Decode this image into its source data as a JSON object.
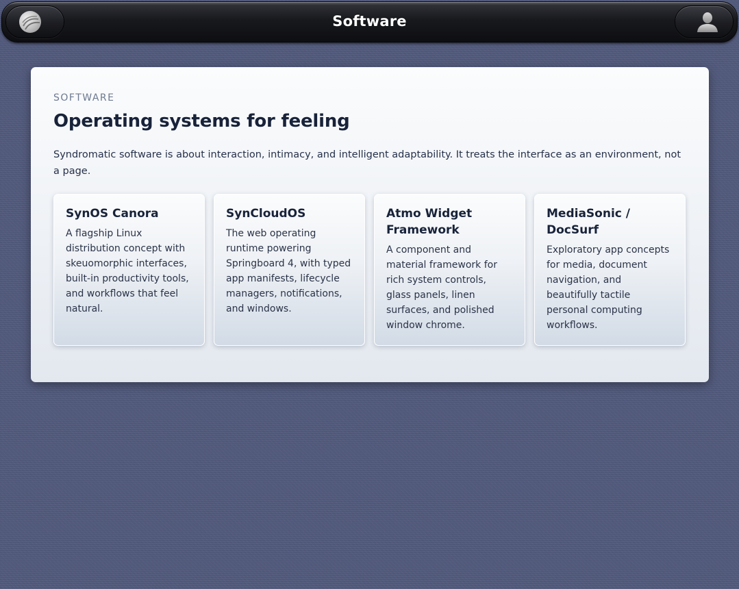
{
  "topbar": {
    "title": "Software",
    "left_button_icon": "sphere-logo-icon",
    "right_button_icon": "user-silhouette-icon"
  },
  "main": {
    "eyebrow": "SOFTWARE",
    "heading": "Operating systems for feeling",
    "lede": "Syndromatic software is about interaction, intimacy, and intelligent adaptability. It treats the interface as an environment, not a page.",
    "cards": [
      {
        "title": "SynOS Canora",
        "body": "A flagship Linux distribution concept with skeuomorphic interfaces, built-in productivity tools, and workflows that feel natural."
      },
      {
        "title": "SynCloudOS",
        "body": "The web operating runtime powering Springboard 4, with typed app manifests, lifecycle managers, notifications, and windows."
      },
      {
        "title": "Atmo Widget Framework",
        "body": "A component and material framework for rich system controls, glass panels, linen surfaces, and polished window chrome."
      },
      {
        "title": "MediaSonic / DocSurf",
        "body": "Exploratory app concepts for media, document navigation, and beautifully tactile personal computing workflows."
      }
    ]
  },
  "colors": {
    "background_linen": "#525a7d",
    "topbar": "#16171b",
    "panel": "#f3f5f8",
    "heading_text": "#18233a",
    "eyebrow_text": "#6d7990"
  }
}
